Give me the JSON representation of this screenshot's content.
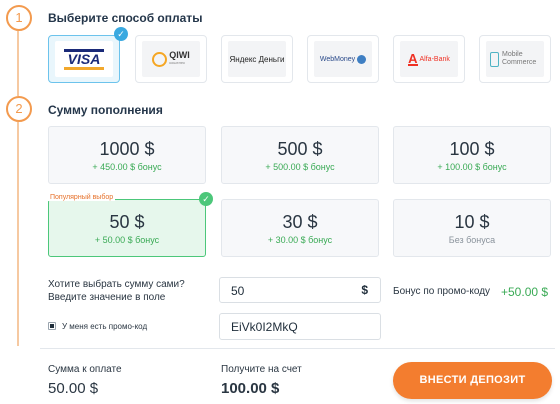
{
  "steps": [
    {
      "number": "1",
      "title": "Выберите способ оплаты"
    },
    {
      "number": "2",
      "title": "Сумму пополнения"
    }
  ],
  "payment_methods": [
    {
      "label": "VISA",
      "selected": true,
      "icon": "visa-logo"
    },
    {
      "label": "QIWI",
      "sub": "кошелек",
      "selected": false,
      "icon": "qiwi-logo"
    },
    {
      "label": "Яндекс Деньги",
      "selected": false,
      "icon": "yandex-money-logo"
    },
    {
      "label": "WebMoney",
      "selected": false,
      "icon": "webmoney-logo"
    },
    {
      "label": "Alfa-Bank",
      "selected": false,
      "icon": "alfa-bank-logo"
    },
    {
      "label": "Mobile Commerce",
      "selected": false,
      "icon": "mobile-phone-icon"
    }
  ],
  "amounts": [
    {
      "value": "1000 $",
      "bonus": "+ 450.00 $ бонус",
      "selected": false
    },
    {
      "value": "500 $",
      "bonus": "+ 500.00 $ бонус",
      "selected": false
    },
    {
      "value": "100 $",
      "bonus": "+ 100.00 $ бонус",
      "selected": false
    },
    {
      "value": "50 $",
      "bonus": "+ 50.00 $ бонус",
      "selected": true
    },
    {
      "value": "30 $",
      "bonus": "+ 30.00 $ бонус",
      "selected": false
    },
    {
      "value": "10 $",
      "bonus": "Без бонуса",
      "selected": false
    }
  ],
  "popular_label": "Популярный выбор",
  "custom_amount": {
    "prompt_line1": "Хотите выбрать сумму сами?",
    "prompt_line2": "Введите значение в поле",
    "value": "50",
    "currency": "$"
  },
  "promo": {
    "checkbox_label": "У меня есть промо-код",
    "code": "EiVk0I2MkQ",
    "bonus_label": "Бонус по промо-коду",
    "bonus_value": "+50.00 $"
  },
  "summary": {
    "to_pay_label": "Сумма к оплате",
    "to_pay_value": "50.00 $",
    "receive_label": "Получите на счет",
    "receive_value": "100.00 $"
  },
  "deposit_button": "ВНЕСТИ ДЕПОЗИТ",
  "colors": {
    "accent": "#f37d2f",
    "selected_green": "#4cc77a",
    "selected_blue": "#3aa9e0",
    "bonus_green": "#3aaa55"
  }
}
